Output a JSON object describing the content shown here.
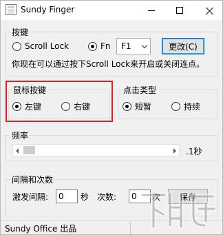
{
  "window": {
    "title": "Sundy Finger"
  },
  "trigger_group": {
    "title": "按键",
    "options": [
      "Scroll Lock",
      "Fn"
    ],
    "selected": "Fn",
    "key_select": "F1",
    "change_button": "更改(C)",
    "hint": "你现在可以通过按下Scroll Lock来开启或关闭连点。"
  },
  "mouse_group": {
    "title": "鼠标按键",
    "options": [
      "左键",
      "右键"
    ],
    "selected": "左键"
  },
  "click_group": {
    "title": "点击类型",
    "options": [
      "短暂",
      "持续"
    ],
    "selected": "短暂"
  },
  "frequency_group": {
    "title": "频率",
    "value_label": ".1秒",
    "slider_fraction": 0.08
  },
  "interval_group": {
    "title": "间隔和次数",
    "interval_label": "激发间隔:",
    "interval_value": "0",
    "interval_unit": "秒",
    "count_label": "次数:",
    "count_value": "0",
    "count_unit": "次",
    "save_button": "保存"
  },
  "status": {
    "text": "Sundy Office 出品"
  },
  "watermark": {
    "text": "下载吧"
  },
  "colors": {
    "highlight": "#e02020",
    "accent": "#0078d7"
  }
}
